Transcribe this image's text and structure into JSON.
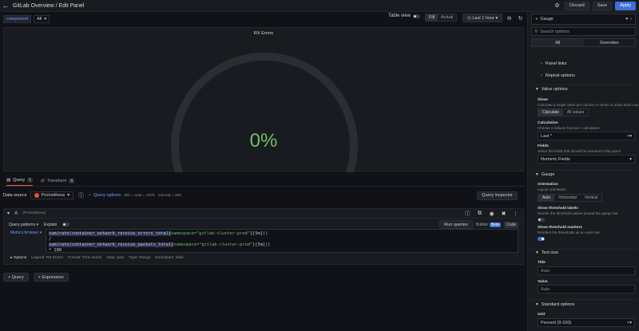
{
  "topbar": {
    "title": "GitLab Overview / Edit Panel",
    "discard_label": "Discard",
    "save_label": "Save",
    "apply_label": "Apply"
  },
  "variables": {
    "label": "component",
    "value": "All"
  },
  "view": {
    "table_view_label": "Table view",
    "fill_label": "Fill",
    "actual_label": "Actual",
    "time_range": "Last 1 hour"
  },
  "panel": {
    "title": "RX Errors",
    "value": "0%",
    "gauge_level": 0,
    "value_color": "#73bf69"
  },
  "query_tabs": [
    {
      "label": "Query",
      "count": "1"
    },
    {
      "label": "Transform",
      "count": "0"
    }
  ],
  "datasource": {
    "label": "Data source",
    "name": "Prometheus",
    "query_options_label": "Query options",
    "meta": "MD = auto = 1878",
    "interval": "Interval = 30s",
    "inspector_label": "Query inspector"
  },
  "query": {
    "letter": "A",
    "source": "(Prometheus)",
    "patterns_label": "Query patterns",
    "explain_label": "Explain",
    "run_label": "Run queries",
    "builder_label": "Builder",
    "beta_label": "Beta",
    "code_label": "Code",
    "metrics_browser_label": "Metrics browser",
    "line1_fn": "sum(rate(",
    "line1_metric": "container_network_receive_errors_total{",
    "line1_label": "namespace=\"gitlab-cluster-prod\"",
    "line1_end": "}[5m]))",
    "line2": "/",
    "line3_fn": "sum(rate(",
    "line3_metric": "container_network_receive_packets_total{",
    "line3_label": "namespace=\"gitlab-cluster-prod\"",
    "line3_end": "}[5m]))",
    "line4": "* 100",
    "options_label": "Options",
    "opt_legend": "Legend: RX Errors",
    "opt_format": "Format: Time series",
    "opt_step": "Step: auto",
    "opt_type": "Type: Range",
    "opt_exemplars": "Exemplars: false"
  },
  "add": {
    "query_label": "Query",
    "expression_label": "Expression"
  },
  "sidebar": {
    "viz": "Gauge",
    "search_placeholder": "Search options",
    "tab_all": "All",
    "tab_overrides": "Overrides",
    "panel_links": "Panel links",
    "repeat_options": "Repeat options",
    "value_options": "Value options",
    "show_label": "Show",
    "show_desc": "Calculate a single value per column or series or show each row",
    "show_calculate": "Calculate",
    "show_all_values": "All values",
    "calc_label": "Calculation",
    "calc_desc": "Choose a reducer function / calculation",
    "calc_value": "Last *",
    "fields_label": "Fields",
    "fields_desc": "Select the fields that should be included in the panel",
    "fields_value": "Numeric Fields",
    "gauge_section": "Gauge",
    "orientation_label": "Orientation",
    "orientation_desc": "Layout orientation",
    "orient_auto": "Auto",
    "orient_horizontal": "Horizontal",
    "orient_vertical": "Vertical",
    "thr_labels_label": "Show threshold labels",
    "thr_labels_desc": "Render the threshold values around the gauge bar",
    "thr_markers_label": "Show threshold markers",
    "thr_markers_desc": "Renders the thresholds as an outer bar",
    "text_size": "Text size",
    "title_label": "Title",
    "title_placeholder": "Auto",
    "value_label": "Value",
    "value_placeholder": "Auto",
    "standard_options": "Standard options",
    "unit_label": "Unit",
    "unit_value": "Percent (0-100)"
  }
}
